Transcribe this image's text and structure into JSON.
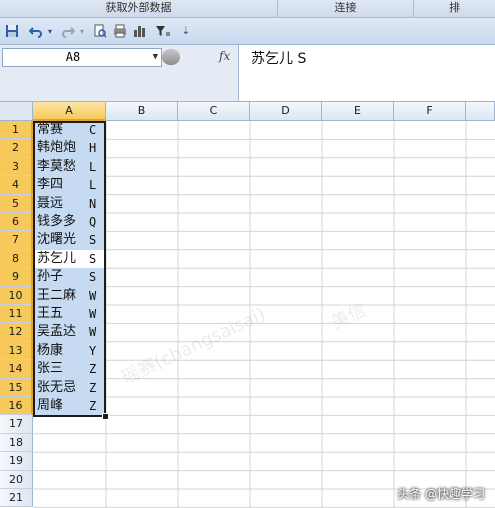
{
  "ribbon": {
    "groups": [
      "获取外部数据",
      "连接",
      "排"
    ]
  },
  "toolbar": {
    "icons": [
      "save-icon",
      "undo-icon",
      "redo-icon",
      "print-preview-icon",
      "print-icon",
      "chart-icon",
      "filter-icon",
      "customize-icon"
    ]
  },
  "name_box": {
    "value": "A8"
  },
  "formula_bar": {
    "fx_label": "fx",
    "content": "苏乞儿 S"
  },
  "columns": [
    "A",
    "B",
    "C",
    "D",
    "E",
    "F"
  ],
  "rows": [
    "1",
    "2",
    "3",
    "4",
    "5",
    "6",
    "7",
    "8",
    "9",
    "10",
    "11",
    "12",
    "13",
    "14",
    "15",
    "16",
    "17",
    "18",
    "19",
    "20",
    "21"
  ],
  "cells_a": [
    {
      "name": "常赛",
      "letter": "C"
    },
    {
      "name": "韩炮炮",
      "letter": "H"
    },
    {
      "name": "李莫愁",
      "letter": "L"
    },
    {
      "name": "李四",
      "letter": "L"
    },
    {
      "name": "聂远",
      "letter": "N"
    },
    {
      "name": "钱多多",
      "letter": "Q"
    },
    {
      "name": "沈曙光",
      "letter": "S"
    },
    {
      "name": "苏乞儿",
      "letter": "S"
    },
    {
      "name": "孙子",
      "letter": "S"
    },
    {
      "name": "王二麻",
      "letter": "W"
    },
    {
      "name": "王五",
      "letter": "W"
    },
    {
      "name": "吴孟达",
      "letter": "W"
    },
    {
      "name": "杨康",
      "letter": "Y"
    },
    {
      "name": "张三",
      "letter": "Z"
    },
    {
      "name": "张无忌",
      "letter": "Z"
    },
    {
      "name": "周峰",
      "letter": "Z"
    }
  ],
  "watermarks": [
    "sai",
    "美信",
    "瑶赛(changsaisai)"
  ],
  "credit": "头条 @快趣学习"
}
